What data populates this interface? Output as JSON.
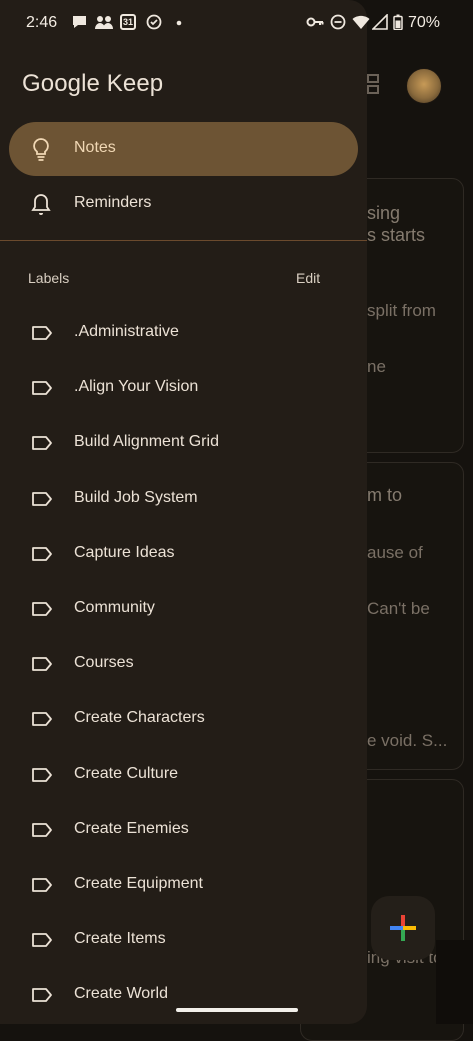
{
  "status_bar": {
    "time": "2:46",
    "calendar_day": "31",
    "battery": "70%"
  },
  "app": {
    "title": "Google Keep"
  },
  "nav": {
    "notes": "Notes",
    "reminders": "Reminders"
  },
  "labels_section": {
    "title": "Labels",
    "edit": "Edit",
    "items": [
      ".Administrative",
      ".Align Your Vision",
      "Build Alignment Grid",
      "Build Job System",
      "Capture Ideas",
      "Community",
      "Courses",
      "Create Characters",
      "Create Culture",
      "Create Enemies",
      "Create Equipment",
      "Create Items",
      "Create World"
    ]
  },
  "background_notes": {
    "card1_line1": "sing",
    "card1_line2": "s starts",
    "card1_line3": "split from",
    "card1_line4": "ne",
    "card2_line1": "m to",
    "card2_line2": "ause of",
    "card2_line3": "Can't be",
    "card2_line4": "e void. S...",
    "card3_line1": "ing visit to"
  },
  "colors": {
    "drawer": "#231d17",
    "selected": "#6d5434",
    "divider": "#6b4a2d"
  }
}
